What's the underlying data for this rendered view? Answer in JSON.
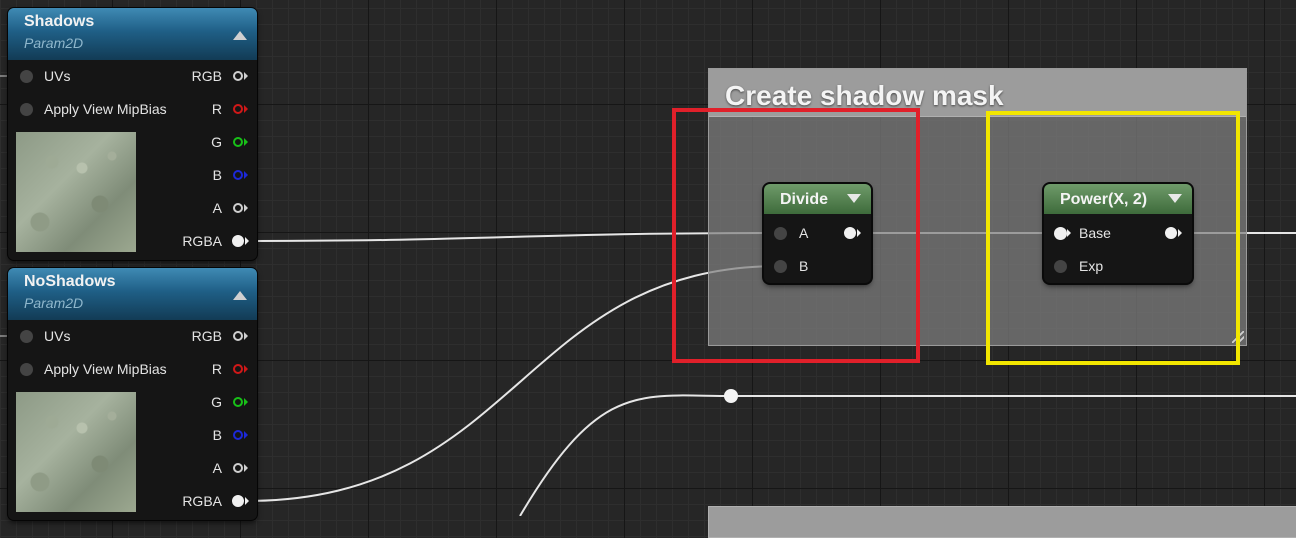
{
  "texture_nodes": [
    {
      "title": "Shadows",
      "subtitle": "Param2D",
      "inputs": [
        {
          "label": "UVs"
        },
        {
          "label": "Apply View MipBias"
        }
      ],
      "outputs": [
        {
          "label": "RGB",
          "color": "#cfcfcf"
        },
        {
          "label": "R",
          "color": "#d01818"
        },
        {
          "label": "G",
          "color": "#18c018"
        },
        {
          "label": "B",
          "color": "#1c28d8"
        },
        {
          "label": "A",
          "color": "#cfcfcf"
        },
        {
          "label": "RGBA",
          "color": "#f0f0f0"
        }
      ]
    },
    {
      "title": "NoShadows",
      "subtitle": "Param2D",
      "inputs": [
        {
          "label": "UVs"
        },
        {
          "label": "Apply View MipBias"
        }
      ],
      "outputs": [
        {
          "label": "RGB",
          "color": "#cfcfcf"
        },
        {
          "label": "R",
          "color": "#d01818"
        },
        {
          "label": "G",
          "color": "#18c018"
        },
        {
          "label": "B",
          "color": "#1c28d8"
        },
        {
          "label": "A",
          "color": "#cfcfcf"
        },
        {
          "label": "RGBA",
          "color": "#f0f0f0"
        }
      ]
    }
  ],
  "comment": {
    "title": "Create shadow mask"
  },
  "divide_node": {
    "title": "Divide",
    "inputs": [
      {
        "label": "A"
      },
      {
        "label": "B"
      }
    ]
  },
  "power_node": {
    "title": "Power(X, 2)",
    "inputs": [
      {
        "label": "Base"
      },
      {
        "label": "Exp"
      }
    ]
  },
  "colors": {
    "highlight_red": "#e0202a",
    "highlight_yellow": "#f2e600",
    "texture_header": "#1f5f86",
    "math_header": "#4e7a4a",
    "background": "#262626"
  }
}
